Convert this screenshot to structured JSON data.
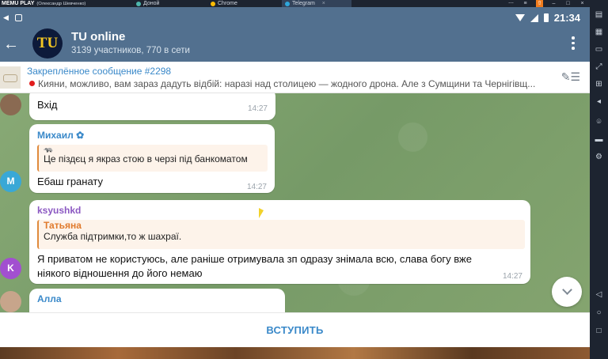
{
  "emulator": {
    "brand": "MEMU PLAY",
    "user": "(Олександр Шевченко)",
    "tabs": [
      {
        "label": "Доной",
        "color": "#4db6ac"
      },
      {
        "label": "Chrome",
        "color": "#fbbc05"
      },
      {
        "label": "Telegram",
        "color": "#2ea6da",
        "active": true
      }
    ],
    "tab_close": "×",
    "controls": [
      "⋯",
      "≡",
      "⇧",
      "–",
      "□",
      "×"
    ]
  },
  "status_bar": {
    "time": "21:34"
  },
  "header": {
    "back_icon": "arrow-left-icon",
    "avatar_text": "TU",
    "title": "TU online",
    "subtitle": "3139 участников, 770 в сети"
  },
  "pinned": {
    "title": "Закреплённое сообщение #2298",
    "text": "Кияни, можливо, вам зараз дадуть відбій: наразі над столицею — жодного дрона. Але з Сумщини та Чернігівщ..."
  },
  "messages": [
    {
      "text": "Вхід",
      "time": "14:27"
    },
    {
      "name": "Михаил",
      "name_color": "#3a89c9",
      "avatar_letter": "M",
      "avatar_color": "#39a8d6",
      "quote_icon": "🦡",
      "quote_text": "Це піздєц я якраз стою в черзі під банкоматом",
      "text": "Ебаш гранату",
      "time": "14:27"
    },
    {
      "name": "ksyushkd",
      "name_color": "#8b58c2",
      "avatar_letter": "K",
      "avatar_color": "#a24fd0",
      "quote_author": "Татьяна",
      "quote_text": "Служба підтримки,то ж шахраї.",
      "text_line1": "Я приватом не користуюсь, але раніше отримувала зп одразу знімала всю, слава богу вже",
      "text_line2": "ніякого відношення до його немаю",
      "time": "14:27"
    },
    {
      "name": "Алла",
      "name_color": "#3a89c9"
    }
  ],
  "join_button": "ВСТУПИТЬ"
}
